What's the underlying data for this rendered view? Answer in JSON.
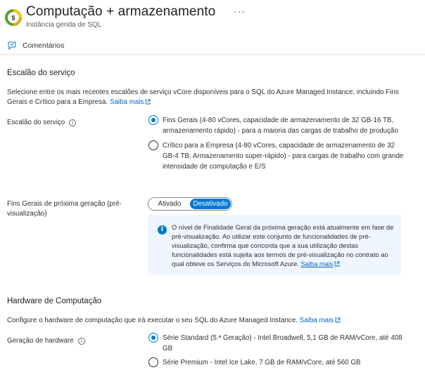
{
  "header": {
    "title": "Computação + armazenamento",
    "subtitle": "Instância gerida de SQL",
    "more_label": "···"
  },
  "toolbar": {
    "feedback_label": "Comentários"
  },
  "service_tier": {
    "heading": "Escalão do serviço",
    "description": "Selecione entre os mais recentes escalões de serviço vCore disponíveis para o SQL do Azure Managed Instance, incluindo Fins Gerais e Crítico para a Empresa.",
    "learn_more": "Saiba mais",
    "field_label": "Escalão do serviço",
    "options": [
      {
        "label": "Fins Gerais (4-80 vCores, capacidade de armazenamento de 32 GB-16 TB, armazenamento rápido) - para a maioria das cargas de trabalho de produção",
        "selected": true
      },
      {
        "label": "Crítico para a Empresa (4-80 vCores, capacidade de armazenamento de 32 GB-4 TB, Armazenamento super-rápido) - para cargas de trabalho com grande intensidade de computação e E/S",
        "selected": false
      }
    ]
  },
  "next_gen": {
    "field_label": "Fins Gerais de próxima geração (pré-visualização)",
    "toggle_on": "Ativado",
    "toggle_off": "Desativado",
    "selected": "Desativado",
    "info_text": "O nível de Finalidade Geral da próxima geração está atualmente em fase de pré-visualização. Ao utilizar este conjunto de funcionalidades de pré-visualização, confirma que concorda que a sua utilização destas funcionalidades está sujeita aos termos de pré-visualização no contrato ao qual obteve os Serviços do Microsoft Azure.",
    "info_link": "Saiba mais"
  },
  "hardware": {
    "heading": "Hardware de Computação",
    "description": "Configure o hardware de computação que irá executar o seu SQL do Azure Managed Instance.",
    "learn_more": "Saiba mais",
    "field_label": "Geração de hardware",
    "options": [
      {
        "label": "Série Standard (5.ª Geração) - Intel Broadwell, 5,1 GB de RAM/vCore, até 408 GB",
        "selected": true
      },
      {
        "label": "Série Premium - Intel Ice Lake, 7 GB de RAM/vCore, até 560 GB",
        "selected": false
      }
    ]
  },
  "colors": {
    "accent": "#0078d4",
    "link": "#0066c4",
    "info_bg": "#f0f6ff"
  }
}
